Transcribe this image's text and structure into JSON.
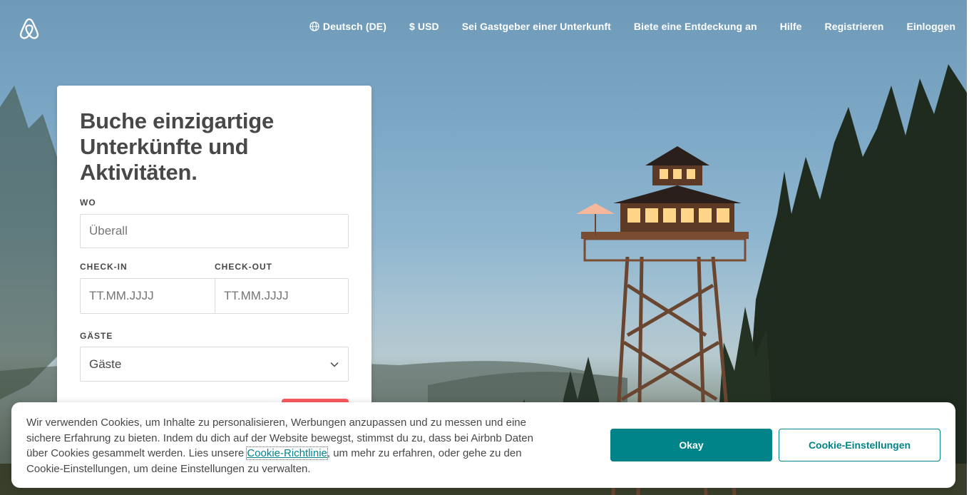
{
  "header": {
    "logo_icon": "airbnb-logo-icon",
    "nav": {
      "language": "Deutsch (DE)",
      "language_icon": "globe-icon",
      "currency": "$ USD",
      "host": "Sei Gastgeber einer Unterkunft",
      "experience": "Biete eine Entdeckung an",
      "help": "Hilfe",
      "signup": "Registrieren",
      "login": "Einloggen"
    }
  },
  "search": {
    "title": "Buche einzigartige Unterkünfte und Aktivitäten.",
    "where_label": "Wo",
    "where_placeholder": "Überall",
    "checkin_label": "Check-in",
    "checkin_placeholder": "TT.MM.JJJJ",
    "checkout_label": "Check-out",
    "checkout_placeholder": "TT.MM.JJJJ",
    "guests_label": "Gäste",
    "guests_value": "Gäste",
    "guests_icon": "chevron-down-icon",
    "accent_color": "#ff5a5f"
  },
  "cookie_banner": {
    "text_before": "Wir verwenden Cookies, um Inhalte zu personalisieren, Werbungen anzupassen und zu messen und eine sichere Erfahrung zu bieten. Indem du dich auf der Website bewegst, stimmst du zu, dass bei Airbnb Daten über Cookies gesammelt werden. Lies unsere ",
    "link": "Cookie-Richtlinie",
    "text_after": ", um mehr zu erfahren, oder gehe zu den Cookie-Einstellungen, um deine Einstellungen zu verwalten.",
    "okay_label": "Okay",
    "settings_label": "Cookie-Einstellungen",
    "accent_color": "#008489"
  }
}
